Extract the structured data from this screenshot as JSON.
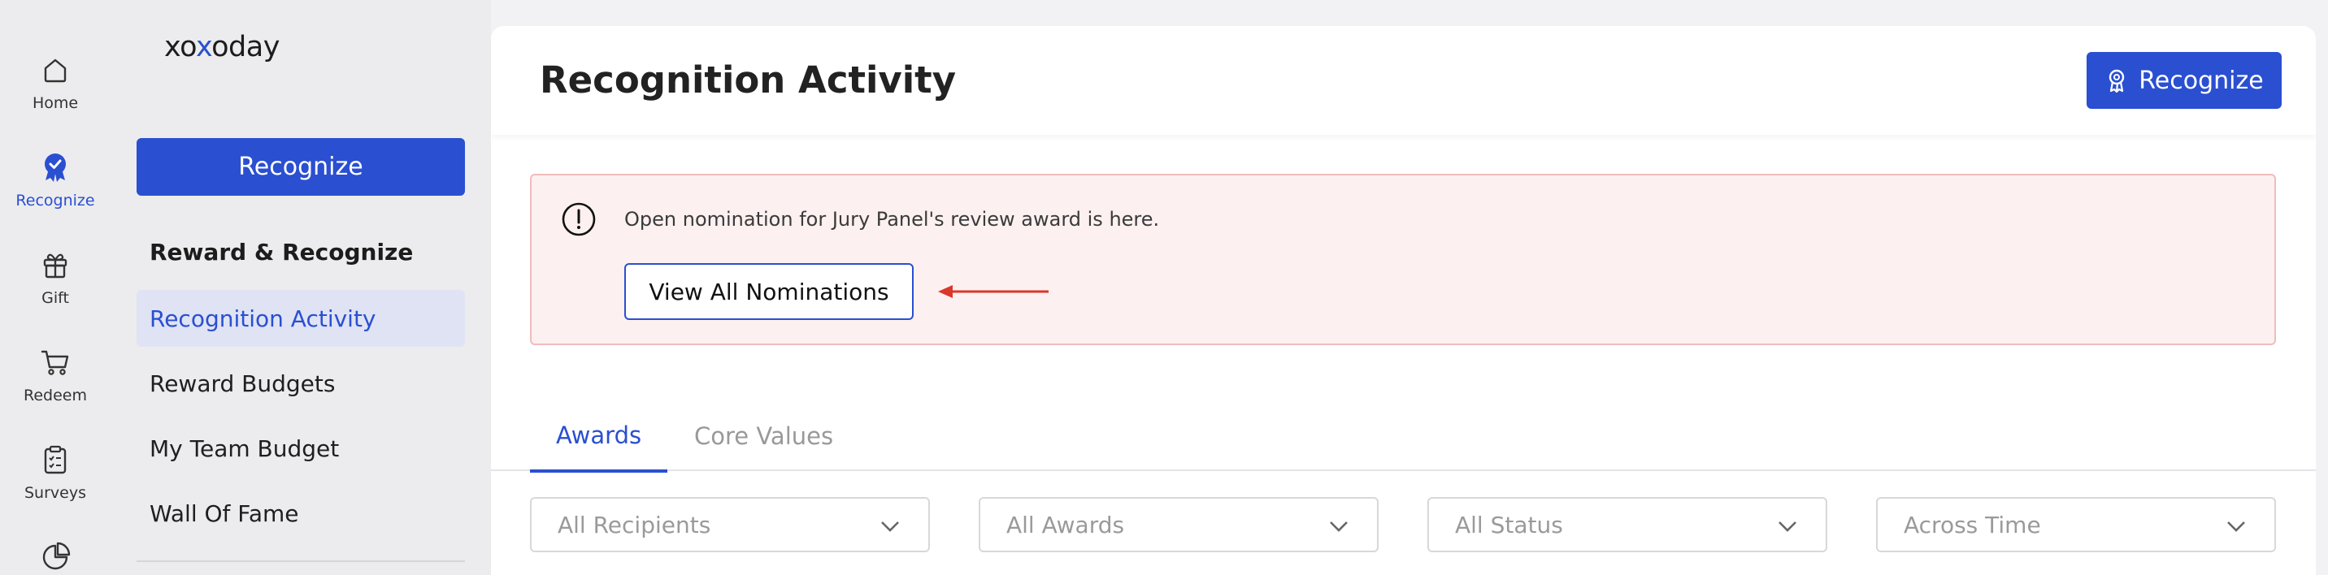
{
  "rail": {
    "items": [
      {
        "label": "Home",
        "icon": "home-icon"
      },
      {
        "label": "Recognize",
        "icon": "recognize-badge-icon",
        "active": true
      },
      {
        "label": "Gift",
        "icon": "gift-icon"
      },
      {
        "label": "Redeem",
        "icon": "cart-icon"
      },
      {
        "label": "Surveys",
        "icon": "clipboard-icon"
      },
      {
        "label": "",
        "icon": "pie-chart-icon"
      }
    ]
  },
  "sidebar": {
    "logo_prefix": "xo",
    "logo_x": "x",
    "logo_suffix": "oday",
    "recognize_button": "Recognize",
    "section_heading": "Reward & Recognize",
    "links": [
      {
        "label": "Recognition Activity",
        "active": true
      },
      {
        "label": "Reward Budgets"
      },
      {
        "label": "My Team Budget"
      },
      {
        "label": "Wall Of Fame"
      }
    ]
  },
  "header": {
    "title": "Recognition Activity",
    "recognize_button": "Recognize"
  },
  "alert": {
    "message": "Open nomination for Jury Panel's review award is here.",
    "button": "View All Nominations",
    "arrow_color": "#d9382b"
  },
  "tabs": [
    {
      "label": "Awards",
      "active": true
    },
    {
      "label": "Core Values"
    }
  ],
  "filters": [
    {
      "placeholder": "All Recipients"
    },
    {
      "placeholder": "All Awards"
    },
    {
      "placeholder": "All Status"
    },
    {
      "placeholder": "Across Time"
    }
  ],
  "colors": {
    "accent": "#2a4fd1",
    "alert_bg": "#fdf0f0",
    "alert_border": "#f0bcbc"
  }
}
